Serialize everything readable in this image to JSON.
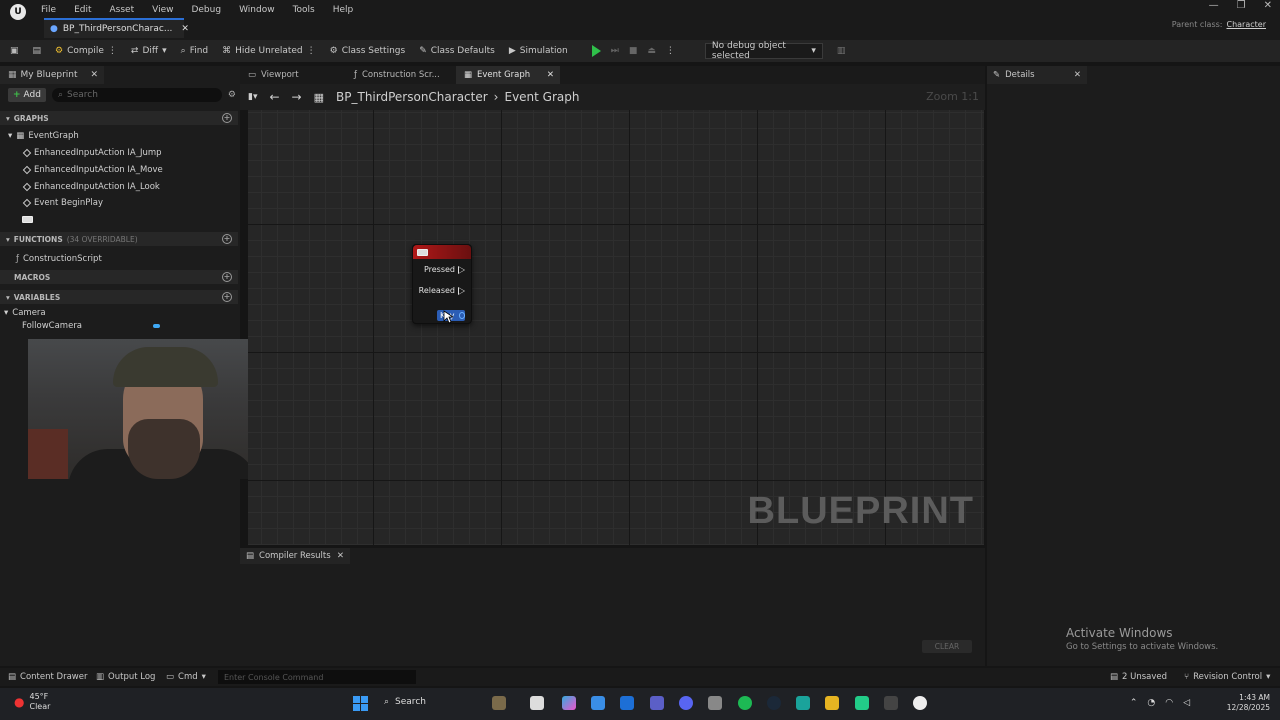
{
  "menu": [
    "File",
    "Edit",
    "Asset",
    "View",
    "Debug",
    "Window",
    "Tools",
    "Help"
  ],
  "document_tab": "BP_ThirdPersonCharac...",
  "parent_class": {
    "label": "Parent class:",
    "value": "Character"
  },
  "toolbar": {
    "compile": "Compile",
    "diff": "Diff",
    "find": "Find",
    "hide_unrelated": "Hide Unrelated",
    "class_settings": "Class Settings",
    "class_defaults": "Class Defaults",
    "simulation": "Simulation",
    "debug_object": "No debug object selected"
  },
  "my_blueprint": {
    "tab": "My Blueprint",
    "add": "Add",
    "search_placeholder": "Search",
    "graphs_header": "GRAPHS",
    "graph_root": "EventGraph",
    "graph_items": [
      "EnhancedInputAction IA_Jump",
      "EnhancedInputAction IA_Move",
      "EnhancedInputAction IA_Look",
      "Event BeginPlay"
    ],
    "functions_header": "FUNCTIONS",
    "functions_note": "(34 OVERRIDABLE)",
    "function_items": [
      "ConstructionScript"
    ],
    "macros_header": "MACROS",
    "variables_header": "VARIABLES",
    "var_category": "Camera",
    "var_items": [
      "FollowCamera"
    ]
  },
  "center_tabs": [
    {
      "label": "Viewport"
    },
    {
      "label": "Construction Scr..."
    },
    {
      "label": "Event Graph"
    }
  ],
  "breadcrumb": {
    "root": "BP_ThirdPersonCharacter",
    "current": "Event Graph"
  },
  "zoom": "Zoom 1:1",
  "watermark": "BLUEPRINT",
  "node": {
    "pins": [
      "Pressed",
      "Released"
    ],
    "key_pin": "Key"
  },
  "compiler_results": {
    "tab": "Compiler Results",
    "clear": "CLEAR"
  },
  "details": {
    "tab": "Details"
  },
  "activate_windows": {
    "title": "Activate Windows",
    "sub": "Go to Settings to activate Windows."
  },
  "statusbar": {
    "content_drawer": "Content Drawer",
    "output_log": "Output Log",
    "cmd": "Cmd",
    "console_placeholder": "Enter Console Command",
    "unsaved": "2 Unsaved",
    "revision_control": "Revision Control"
  },
  "taskbar": {
    "weather_temp": "45°F",
    "weather_desc": "Clear",
    "search": "Search",
    "time": "1:43 AM",
    "date": "12/28/2025"
  },
  "colors": {
    "accent": "#2b6fd6",
    "node_header": "#b01818",
    "play": "#2fc04a",
    "var_pill": "#3fa9f5"
  }
}
